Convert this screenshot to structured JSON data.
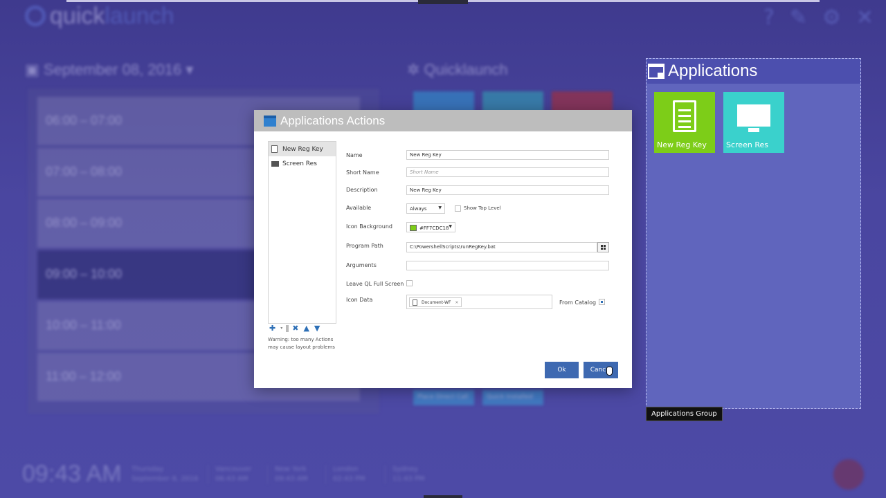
{
  "background": {
    "logo": {
      "part1": "quick",
      "part2": "launch"
    },
    "date_header": "September 08, 2016",
    "quicklaunch_header": "Quicklaunch",
    "slots": [
      {
        "label": "06:00 – 07:00"
      },
      {
        "label": "07:00 – 08:00"
      },
      {
        "label": "08:00 – 09:00"
      },
      {
        "label": "09:00 – 10:00"
      },
      {
        "label": "10:00 – 11:00"
      },
      {
        "label": "11:00 – 12:00"
      }
    ],
    "buttons": [
      "Place Direct Call",
      "Quick Installed"
    ],
    "clock": {
      "time": "09:43 AM",
      "day": "Thursday",
      "date": "September 8, 2016"
    },
    "cities": [
      {
        "name": "Vancouver",
        "time": "06:43 AM"
      },
      {
        "name": "New York",
        "time": "09:43 AM"
      },
      {
        "name": "London",
        "time": "02:43 PM"
      },
      {
        "name": "Sydney",
        "time": "11:43 PM"
      }
    ],
    "colors": {
      "panel": "#6065bd",
      "header": "#4c4fae"
    }
  },
  "applications_panel": {
    "title": "Applications",
    "tiles": [
      {
        "label": "New Reg Key",
        "color": "#7dcd18",
        "icon": "document-icon"
      },
      {
        "label": "Screen Res",
        "color": "#3ad1cc",
        "icon": "monitor-icon"
      }
    ],
    "tooltip": "Applications Group"
  },
  "dialog": {
    "title": "Applications Actions",
    "actions": [
      {
        "label": "New Reg Key",
        "icon": "document-icon"
      },
      {
        "label": "Screen Res",
        "icon": "monitor-icon"
      }
    ],
    "warning": "Warning: too many Actions may cause layout problems",
    "fields": {
      "name_label": "Name",
      "name_value": "New Reg Key",
      "short_name_label": "Short Name",
      "short_name_placeholder": "Short Name",
      "description_label": "Description",
      "description_value": "New Reg Key",
      "available_label": "Available",
      "available_value": "Always",
      "show_top_level_label": "Show Top Level",
      "icon_background_label": "Icon Background",
      "icon_background_value": "#FF7CDC18",
      "program_path_label": "Program Path",
      "program_path_value": "C:\\PowershellScripts\\runRegKey.bat",
      "arguments_label": "Arguments",
      "arguments_value": "",
      "leave_fullscreen_label": "Leave QL Full Screen",
      "icon_data_label": "Icon Data",
      "icon_data_chip": "Document-WF",
      "from_catalog_label": "From Catalog"
    },
    "ok_label": "Ok",
    "cancel_label": "Cancel"
  }
}
